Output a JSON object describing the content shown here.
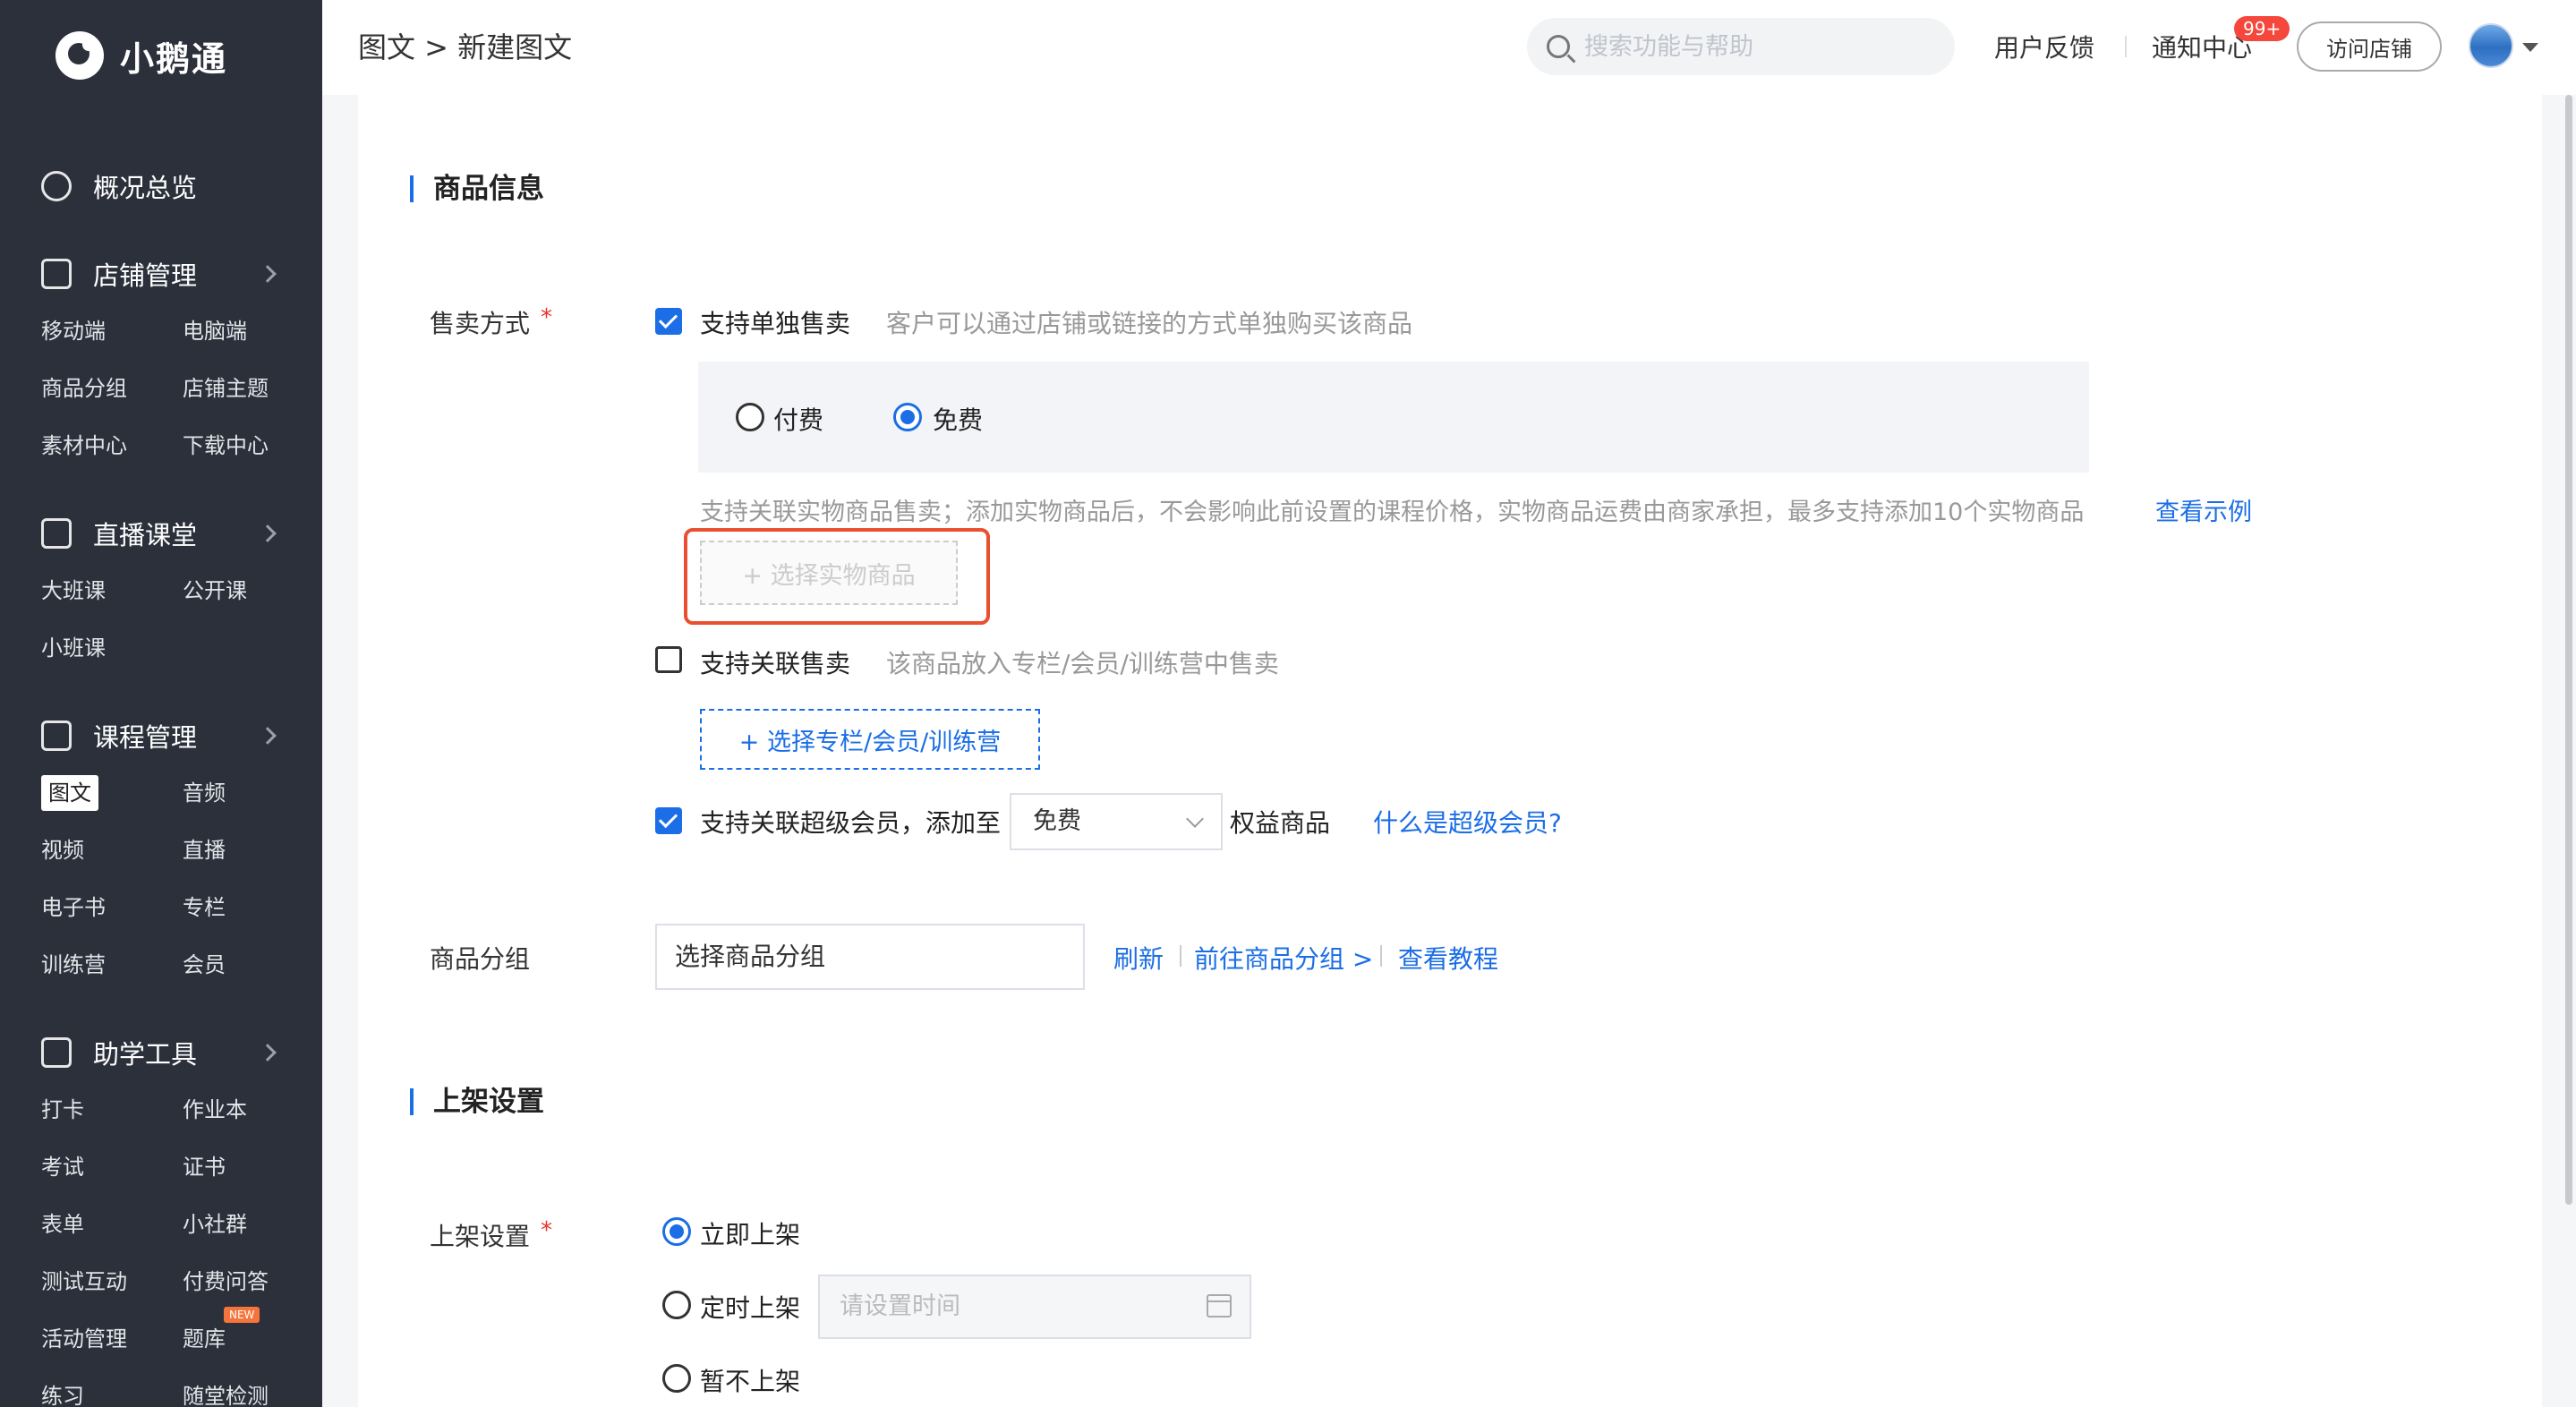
{
  "brand": {
    "name": "小鹅通"
  },
  "header": {
    "breadcrumb": "图文 > 新建图文",
    "search_placeholder": "搜索功能与帮助",
    "feedback": "用户反馈",
    "notifications": "通知中心",
    "notification_badge": "99+",
    "visit_store": "访问店铺"
  },
  "sidebar": {
    "overview": "概况总览",
    "store": {
      "title": "店铺管理",
      "items": [
        "移动端",
        "电脑端",
        "商品分组",
        "店铺主题",
        "素材中心",
        "下载中心"
      ]
    },
    "live": {
      "title": "直播课堂",
      "items": [
        "大班课",
        "公开课",
        "小班课"
      ]
    },
    "course": {
      "title": "课程管理",
      "items": [
        "图文",
        "音频",
        "视频",
        "直播",
        "电子书",
        "专栏",
        "训练营",
        "会员"
      ],
      "active": "图文"
    },
    "tools": {
      "title": "助学工具",
      "items": [
        "打卡",
        "作业本",
        "考试",
        "证书",
        "表单",
        "小社群",
        "测试互动",
        "付费问答",
        "活动管理",
        "题库",
        "练习",
        "随堂检测"
      ],
      "new_badge": "NEW"
    }
  },
  "product_info": {
    "section_title": "商品信息",
    "sale_label": "售卖方式",
    "required_mark": "*",
    "single_sale": {
      "label": "支持单独售卖",
      "desc": "客户可以通过店铺或链接的方式单独购买该商品",
      "checked": true
    },
    "pricing": {
      "paid": "付费",
      "free": "免费",
      "selected": "免费"
    },
    "physical_note": "支持关联实物商品售卖；添加实物商品后，不会影响此前设置的课程价格，实物商品运费由商家承担，最多支持添加10个实物商品",
    "view_example": "查看示例",
    "select_physical": "+ 选择实物商品",
    "linked_sale": {
      "label": "支持关联售卖",
      "desc": "该商品放入专栏/会员/训练营中售卖",
      "checked": false
    },
    "select_column": "+ 选择专栏/会员/训练营",
    "super_member": {
      "label": "支持关联超级会员，添加至",
      "select_value": "免费",
      "suffix": "权益商品",
      "help": "什么是超级会员?",
      "checked": true
    },
    "group_label": "商品分组",
    "group_placeholder": "选择商品分组",
    "refresh": "刷新",
    "goto_group": "前往商品分组 >",
    "tutorial": "查看教程"
  },
  "listing": {
    "section_title": "上架设置",
    "label": "上架设置",
    "required_mark": "*",
    "options": [
      "立即上架",
      "定时上架",
      "暂不上架"
    ],
    "selected": "立即上架",
    "time_placeholder": "请设置时间"
  },
  "colors": {
    "accent": "#1b6ee6",
    "sidebar_bg": "#2b303b",
    "highlight": "#e8502f",
    "badge": "#f5473b"
  }
}
